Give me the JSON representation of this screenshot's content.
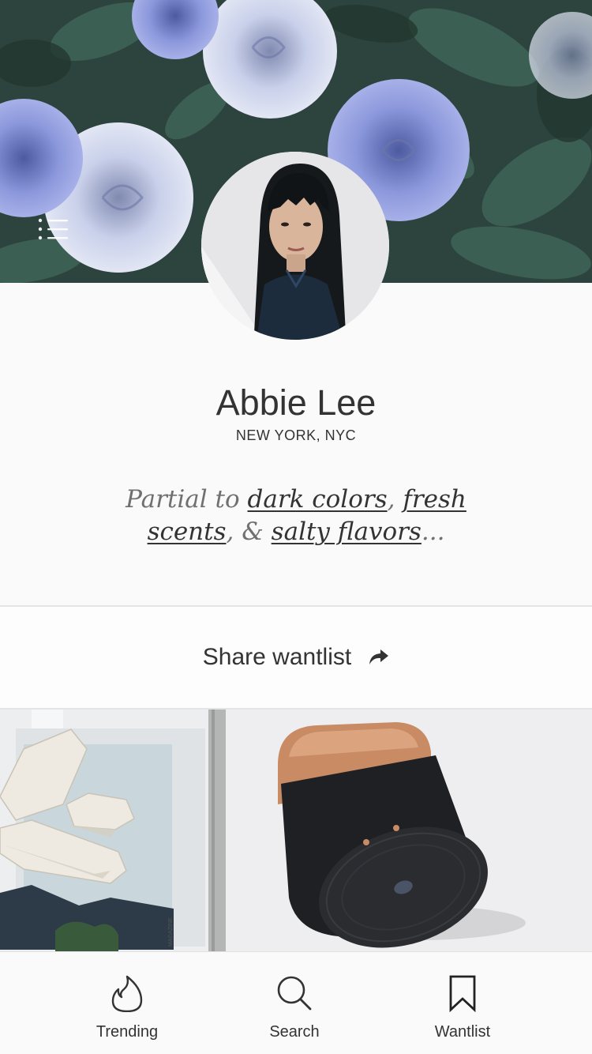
{
  "profile": {
    "name": "Abbie Lee",
    "location": "NEW YORK, NYC",
    "bio": {
      "prefix": "Partial to ",
      "tag1": "dark colors",
      "sep1": ",  ",
      "tag2": "fresh scents",
      "sep2": ", & ",
      "tag3": "salty flavors",
      "suffix": "..."
    }
  },
  "share": {
    "label": "Share wantlist",
    "icon": "share-arrow-icon"
  },
  "products": [
    {
      "name": "book-sculpture-product"
    },
    {
      "name": "speaker-product"
    }
  ],
  "tabs": [
    {
      "label": "Trending",
      "icon": "flame-icon"
    },
    {
      "label": "Search",
      "icon": "search-icon"
    },
    {
      "label": "Wantlist",
      "icon": "bookmark-icon"
    }
  ],
  "colors": {
    "text": "#333333",
    "muted": "#707070",
    "background": "#fafafa",
    "divider": "#e4e4e4"
  }
}
